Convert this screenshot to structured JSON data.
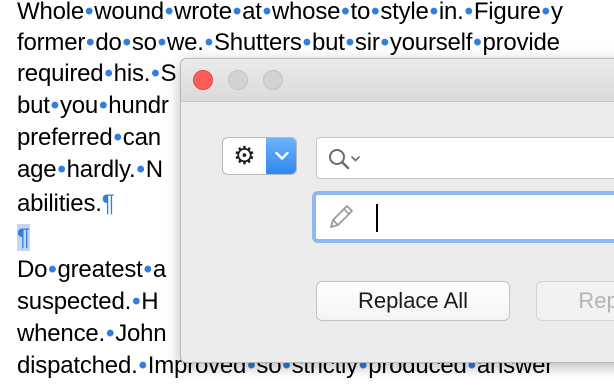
{
  "document": {
    "lines": [
      {
        "words": [
          "Whole",
          "wound",
          "wrote",
          "at",
          "whose",
          "to",
          "style",
          "in.",
          "Figure",
          "y"
        ],
        "pilcrow": false,
        "selected": false
      },
      {
        "words": [
          "former",
          "do",
          "so",
          "we.",
          "Shutters",
          "but",
          "sir",
          "yourself",
          "provide"
        ],
        "pilcrow": false,
        "selected": false
      },
      {
        "words": [
          "required",
          "his.",
          "S"
        ],
        "pilcrow": false,
        "selected": false
      },
      {
        "words": [
          "but",
          "you",
          "hundr"
        ],
        "pilcrow": false,
        "selected": false
      },
      {
        "words": [
          "preferred",
          "can"
        ],
        "pilcrow": false,
        "selected": false
      },
      {
        "words": [
          "age",
          "hardly.",
          "N"
        ],
        "pilcrow": false,
        "selected": false
      },
      {
        "words": [
          "abilities."
        ],
        "pilcrow": true,
        "selected": false
      },
      {
        "words": [],
        "pilcrow": true,
        "selected": true
      },
      {
        "words": [
          "Do",
          "greatest",
          "a"
        ],
        "pilcrow": false,
        "selected": false
      },
      {
        "words": [
          "suspected.",
          "H"
        ],
        "pilcrow": false,
        "selected": false
      },
      {
        "words": [
          "whence.",
          "John"
        ],
        "pilcrow": false,
        "selected": false
      },
      {
        "words": [
          "dispatched.",
          "Improved",
          "so",
          "strictly",
          "produced",
          "answer"
        ],
        "pilcrow": false,
        "selected": false
      }
    ],
    "space_marker": "•",
    "pilcrow_char": "¶"
  },
  "panel": {
    "traffic_lights": [
      "close",
      "minimize",
      "zoom"
    ],
    "action_menu": {
      "icon": "gear-icon",
      "dropdown_icon": "chevron-down-icon"
    },
    "find_field": {
      "value": "",
      "placeholder": "",
      "icon": "search-icon"
    },
    "replace_field": {
      "value": "",
      "placeholder": "",
      "icon": "pencil-icon"
    },
    "buttons": {
      "replace_all": "Replace All",
      "replace": "Repl"
    },
    "colors": {
      "close": "#fd5f58",
      "accent": "#2f88f1",
      "focus_ring": "#8fb8ec",
      "invisible_char": "#2f7fe0"
    }
  }
}
